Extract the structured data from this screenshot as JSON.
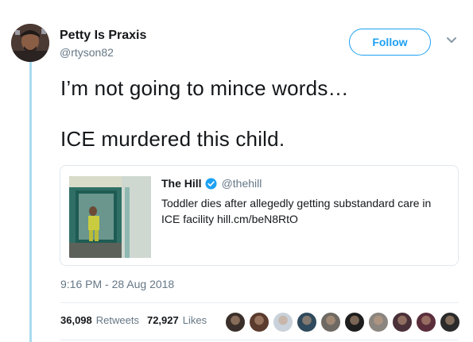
{
  "author": {
    "display_name": "Petty Is Praxis",
    "handle": "@rtyson82",
    "avatar_icon": "avatar"
  },
  "follow_button": {
    "label": "Follow",
    "color": "#1da1f2"
  },
  "menu_icon": "chevron-down-icon",
  "tweet": {
    "line1": "I’m not going to mince words…",
    "line2": "ICE murdered this child."
  },
  "quote": {
    "name": "The Hill",
    "verified": true,
    "handle": "@thehill",
    "text": "Toddler dies after allegedly getting substandard care in ICE facility hill.cm/beN8RtO"
  },
  "timestamp": "9:16 PM - 28 Aug 2018",
  "stats": {
    "retweets_count": "36,098",
    "retweets_label": "Retweets",
    "likes_count": "72,927",
    "likes_label": "Likes"
  },
  "likers": [
    {
      "color": "#3a2f2a"
    },
    {
      "color": "#5a3b2e"
    },
    {
      "color": "#c9d2da"
    },
    {
      "color": "#2f4a5c"
    },
    {
      "color": "#6e6a63"
    },
    {
      "color": "#1e1e1e"
    },
    {
      "color": "#8b8580"
    },
    {
      "color": "#4a3038"
    },
    {
      "color": "#5b2e3c"
    },
    {
      "color": "#2a2a2a"
    }
  ],
  "colors": {
    "text_primary": "#14171a",
    "text_secondary": "#657786",
    "accent": "#1da1f2",
    "thread_line": "#a9dcef"
  }
}
